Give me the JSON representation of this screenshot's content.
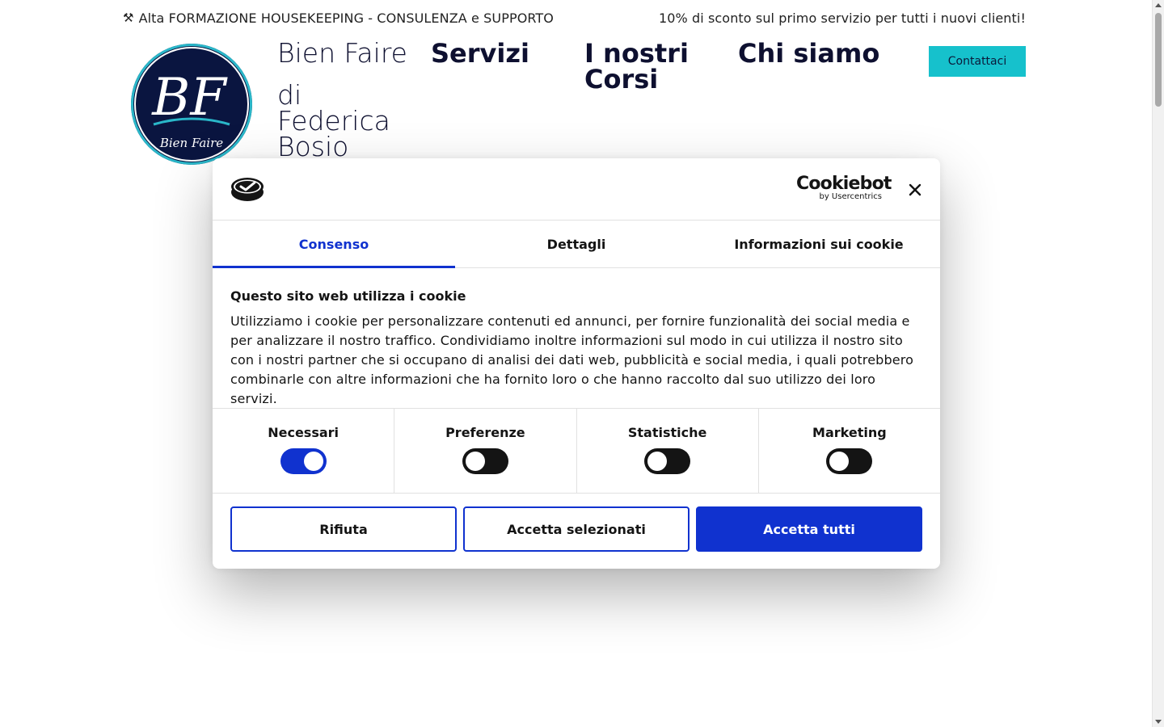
{
  "topbar": {
    "icon": "tools-icon",
    "left_text": "Alta FORMAZIONE HOUSEKEEPING - CONSULENZA e SUPPORTO",
    "right_text": "10% di sconto sul primo servizio per tutti i nuovi clienti!"
  },
  "header": {
    "brand_line1": "Bien Faire",
    "brand_line2": "di",
    "brand_line3": "Federica",
    "brand_line4": "Bosio",
    "nav": {
      "servizi": "Servizi",
      "corsi": "I nostri Corsi",
      "chi_siamo": "Chi siamo"
    },
    "contact_label": "Contattaci",
    "logo_initials": "BF",
    "logo_text": "Bien Faire"
  },
  "cookie_dialog": {
    "brand_name": "Cookiebot",
    "brand_sub": "by Usercentrics",
    "tabs": [
      "Consenso",
      "Dettagli",
      "Informazioni sui cookie"
    ],
    "title": "Questo sito web utilizza i cookie",
    "text": "Utilizziamo i cookie per personalizzare contenuti ed annunci, per fornire funzionalità dei social media e per analizzare il nostro traffico. Condividiamo inoltre informazioni sul modo in cui utilizza il nostro sito con i nostri partner che si occupano di analisi dei dati web, pubblicità e social media, i quali potrebbero combinarle con altre informazioni che ha fornito loro o che hanno raccolto dal suo utilizzo dei loro servizi.",
    "toggles": [
      {
        "label": "Necessari",
        "on": true
      },
      {
        "label": "Preferenze",
        "on": false
      },
      {
        "label": "Statistiche",
        "on": false
      },
      {
        "label": "Marketing",
        "on": false
      }
    ],
    "buttons": {
      "reject": "Rifiuta",
      "accept_selected": "Accetta selezionati",
      "accept_all": "Accetta tutti"
    }
  },
  "colors": {
    "accent": "#1032cf",
    "contact_button": "#16c1cc",
    "nav_text": "#0e1030",
    "logo_bg": "#0a1540"
  }
}
